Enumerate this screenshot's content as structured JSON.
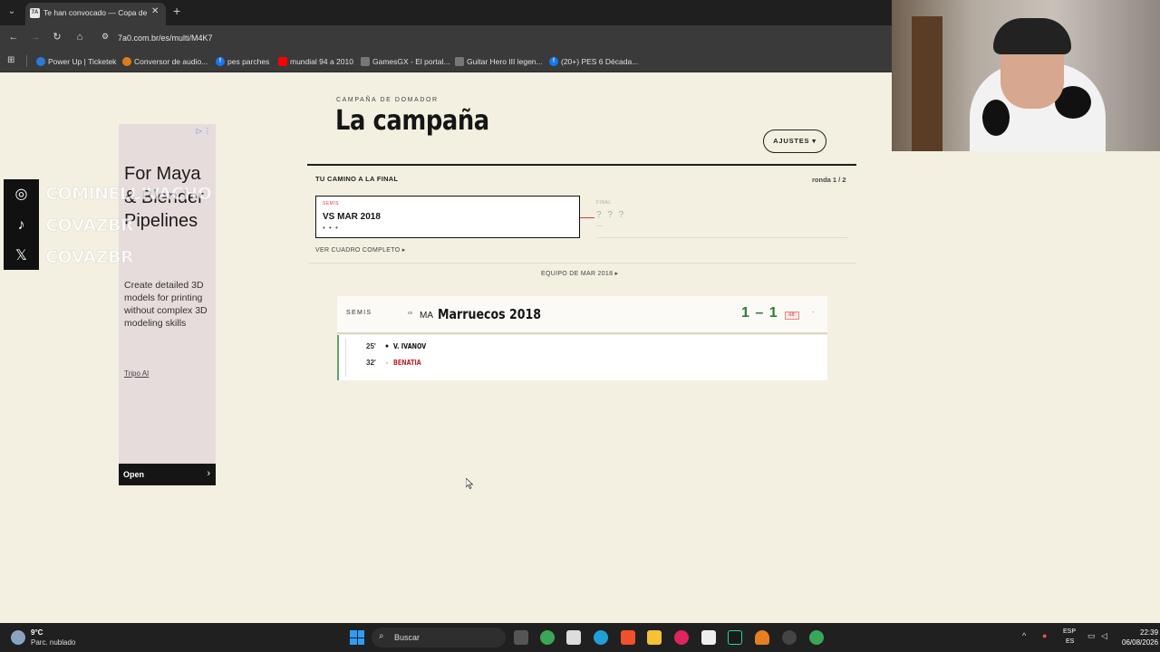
{
  "browser": {
    "tab_title": "Te han convocado — Copa de",
    "tab_favicon": "7A",
    "url": "7a0.com.br/es/multi/M4K7",
    "bookmarks": [
      {
        "label": "Power Up | Ticketek",
        "icon": "ticketek-icon",
        "color": "#2a7ad6"
      },
      {
        "label": "Conversor de audio...",
        "icon": "converter-icon",
        "color": "#e07b1a"
      },
      {
        "label": "pes parches",
        "icon": "facebook-icon",
        "color": "#1877f2"
      },
      {
        "label": "mundial 94 a 2010",
        "icon": "youtube-icon",
        "color": "#ff0000"
      },
      {
        "label": "GamesGX - El portal...",
        "icon": "gamesgx-icon",
        "color": "#777777"
      },
      {
        "label": "Guitar Hero III legen...",
        "icon": "guitarhero-icon",
        "color": "#777777"
      },
      {
        "label": "(20+) PES 6 Década...",
        "icon": "facebook-icon",
        "color": "#1877f2"
      }
    ]
  },
  "ad": {
    "title": "For Maya & Blender Pipelines",
    "description": "Create detailed 3D models for printing without complex 3D modeling skills",
    "brand": "Tripo AI",
    "open_label": "Open"
  },
  "socials": {
    "handles": [
      "COMINELLIVACHO",
      "COVAZBR",
      "COVAZBR"
    ]
  },
  "campaign": {
    "kicker": "CAMPAÑA DE DOMADOR",
    "title": "La campaña",
    "settings_label": "AJUSTES ▾",
    "path_label": "TU CAMINO A LA FINAL",
    "round_label": "ronda 1 / 2",
    "semis": {
      "tag": "SEMIS",
      "opponent": "VS MAR 2018",
      "dots": "• • •"
    },
    "final": {
      "tag": "FINAL",
      "placeholder": "? ? ?",
      "dash": "—"
    },
    "bracket_link": "VER CUADRO COMPLETO ▸",
    "team_label": "EQUIPO DE MAR 2018 ▸",
    "match": {
      "round": "SEMIS",
      "vs": "vs",
      "code": "MA",
      "opponent": "Marruecos 2018",
      "score": "1 – 1",
      "minute": "68'",
      "more": "·"
    },
    "events": [
      {
        "minute": "25'",
        "marker": "●",
        "player": "V. IVANOV",
        "color": "#151515"
      },
      {
        "minute": "32'",
        "marker": "●",
        "player": "BENATIA",
        "color": "#c0282d"
      }
    ]
  },
  "taskbar": {
    "temperature": "9°C",
    "weather": "Parc. nublado",
    "search_placeholder": "Buscar",
    "lang_top": "ESP",
    "lang_bottom": "ES",
    "time": "22:39",
    "date": "06/08/2026",
    "colors": {
      "start": "#2f9df4"
    }
  }
}
